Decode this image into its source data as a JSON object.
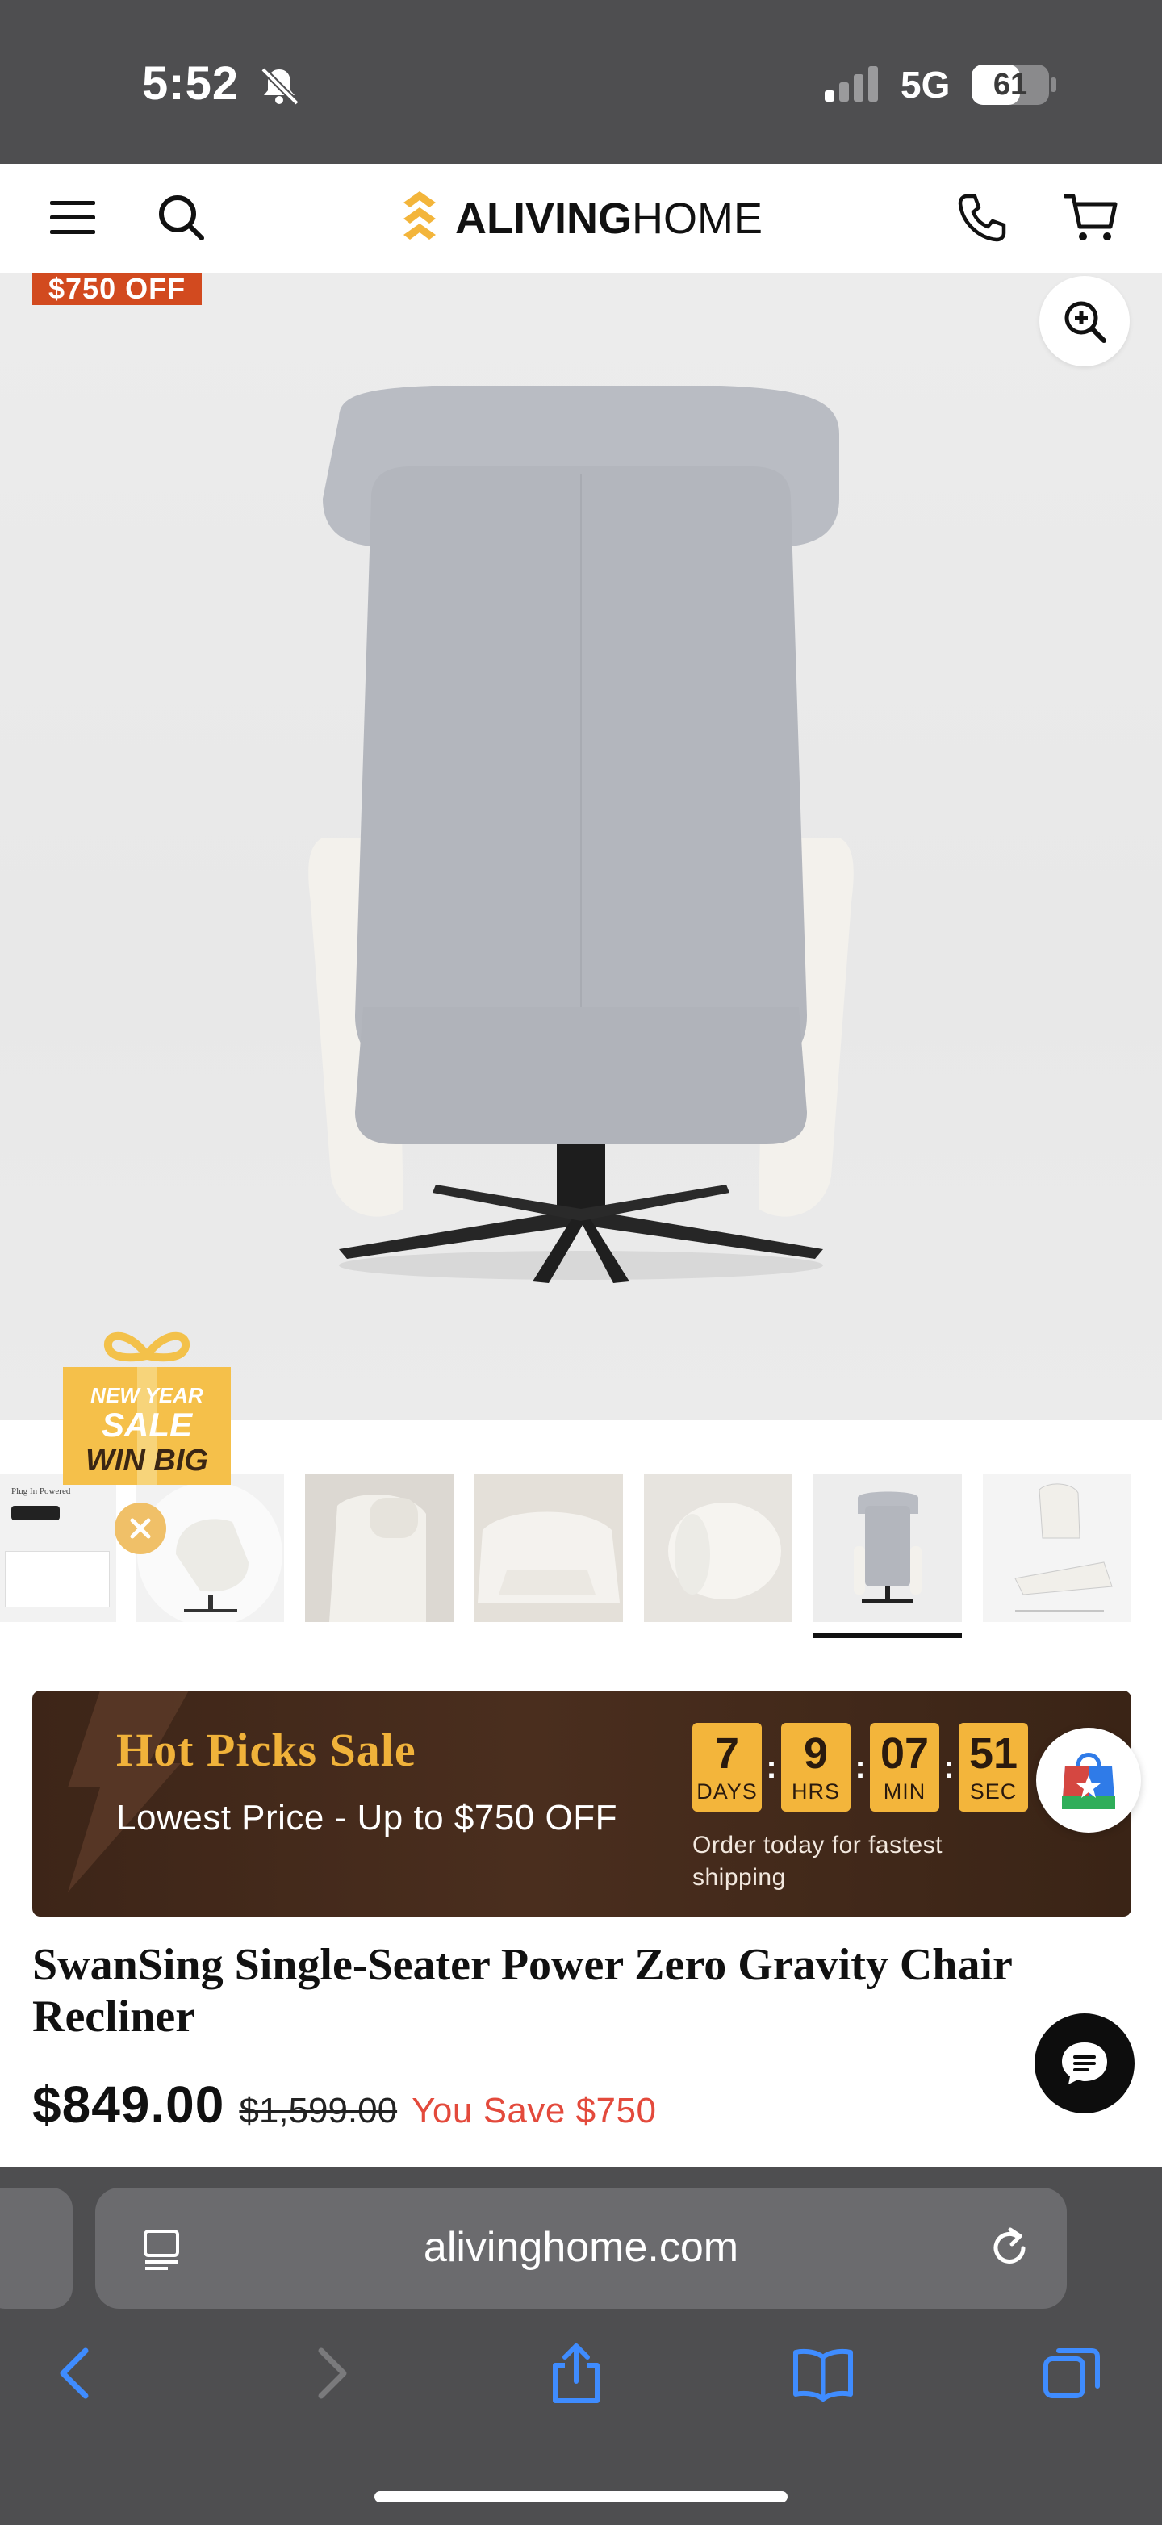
{
  "status_bar": {
    "time": "5:52",
    "network": "5G",
    "battery": "61"
  },
  "header": {
    "logo_bold": "ALIVING",
    "logo_light": "HOME"
  },
  "hero": {
    "discount_badge": "$750 OFF"
  },
  "promo": {
    "line1": "NEW YEAR",
    "line2": "SALE",
    "line3": "WIN BIG",
    "thumb0_text": "Plug In Powered"
  },
  "sale_banner": {
    "title": "Hot Picks Sale",
    "subtitle": "Lowest Price - Up to $750 OFF",
    "countdown": [
      {
        "value": "7",
        "label": "DAYS"
      },
      {
        "value": "9",
        "label": "HRS"
      },
      {
        "value": "07",
        "label": "MIN"
      },
      {
        "value": "51",
        "label": "SEC"
      }
    ],
    "note": "Order today for fastest shipping"
  },
  "product": {
    "title": "SwanSing Single-Seater Power Zero Gravity Chair Recliner",
    "price": "$849.00",
    "original_price": "$1,599.00",
    "savings": "You Save $750"
  },
  "browser": {
    "url": "alivinghome.com"
  },
  "colors": {
    "accent": "#f3b53b",
    "badge": "#d24a1f",
    "save": "#e34a3c"
  }
}
